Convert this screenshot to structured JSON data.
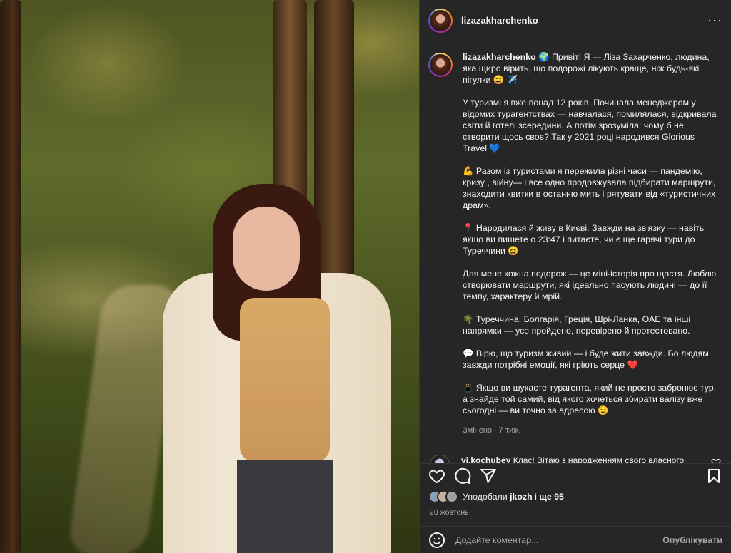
{
  "header": {
    "username": "lizazakharchenko",
    "more_label": "···"
  },
  "caption": {
    "username": "lizazakharchenko",
    "paragraphs": [
      "🌍 Привіт! Я — Ліза Захарченко, людина, яка щиро вірить, що подорожі лікують краще, ніж будь-які пігулки 😄 ✈️",
      "У туризмі я вже понад 12 років. Починала менеджером у відомих турагентствах — навчалася, помилялася, відкривала світи й готелі зсередини. А потім зрозуміла: чому б не створити щось своє? Так у 2021 році народився Glorious Travel 💙",
      "💪 Разом із туристами я пережила різні часи — пандемію, кризу , війну— і все одно продовжувала підбирати маршрути, знаходити квитки в останню мить і рятувати від «туристичних драм».",
      "📍 Народилася й живу в Києві. Завжди на зв'язку — навіть якщо ви пишете о 23:47 і питаєте, чи є ще гарячі тури до Туреччини 😆",
      "Для мене кожна подорож — це міні-історія про щастя. Люблю створювати маршрути, які ідеально пасують людині — до її темпу, характеру й мрій.",
      "🌴 Туреччина, Болгарія, Греція, Шрі-Ланка, ОАЕ та інші напрямки — усе пройдено, перевірено й протестовано.",
      "💬 Вірю, що туризм живий — і буде жити завжди. Бо людям завжди потрібні емоції, які гріють серце ❤️",
      "📱 Якщо ви шукаєте турагента, який не просто забронює тур, а знайде той самий, від якого хочеться збирати валізу вже сьогодні — ви точно за адресою 😉"
    ],
    "edited": "Змінено · 7 тиж."
  },
  "comment": {
    "username": "vi.kochubey",
    "text": "Клас! Вітаю з народженням свого власного проєкту 🙌 Нехай ця пташка взлітає 🥰"
  },
  "likes": {
    "prefix": "Уподобали ",
    "user": "jkozh",
    "middle": " і ",
    "count": "ще 95"
  },
  "date": "20 жовтень",
  "add_comment": {
    "placeholder": "Додайте коментар...",
    "publish_label": "Опублікувати"
  },
  "colors": {
    "panel_bg": "#262626",
    "text": "#f5f5f5",
    "muted": "#a8a8a8"
  }
}
